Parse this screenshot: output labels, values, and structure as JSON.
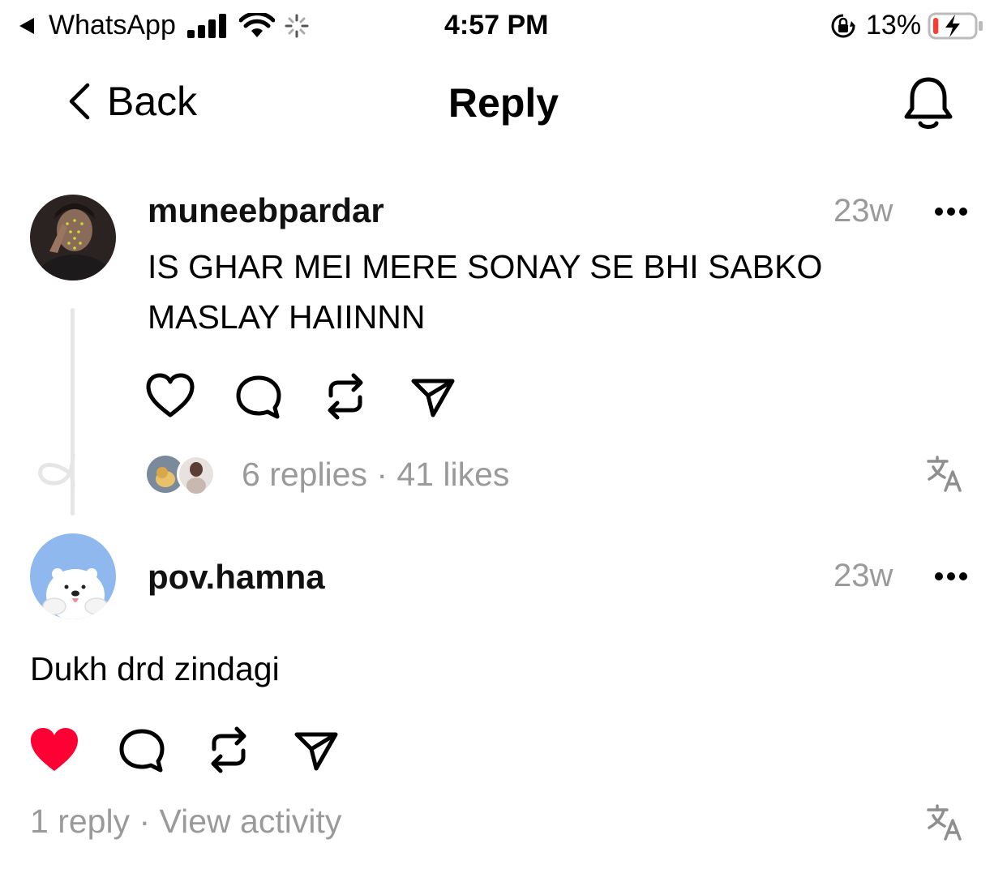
{
  "status_bar": {
    "back_app": "WhatsApp",
    "time": "4:57 PM",
    "battery_percent": "13%",
    "battery_level": 0.13,
    "battery_color": "#ff3b30"
  },
  "nav": {
    "back_label": "Back",
    "title": "Reply",
    "bell_icon": "bell-icon"
  },
  "posts": [
    {
      "username": "muneebpardar",
      "time": "23w",
      "more": "•••",
      "text_line1": "IS GHAR MEI MERE SONAY SE BHI SABKO",
      "text_line2": "MASLAY HAIINNN",
      "liked": false,
      "replies_likes": "6 replies · 41 likes",
      "icons": [
        "heart-icon",
        "comment-icon",
        "repost-icon",
        "share-icon",
        "translate-icon"
      ]
    },
    {
      "username": "pov.hamna",
      "time": "23w",
      "more": "•••",
      "text": "Dukh drd zindagi",
      "liked": true,
      "like_color": "#ff0034",
      "replies_activity": "1 reply · View activity",
      "icons": [
        "heart-filled-icon",
        "comment-icon",
        "repost-icon",
        "share-icon",
        "translate-icon"
      ]
    }
  ]
}
